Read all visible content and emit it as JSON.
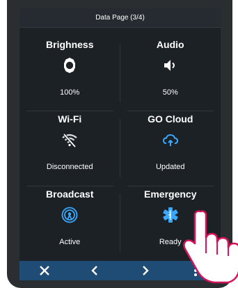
{
  "header": {
    "title": "Data Page (3/4)"
  },
  "tiles": [
    {
      "title": "Brighness",
      "value": "100%",
      "icon": "brightness-icon"
    },
    {
      "title": "Audio",
      "value": "50%",
      "icon": "speaker-icon"
    },
    {
      "title": "Wi-Fi",
      "value": "Disconnected",
      "icon": "wifi-off-icon"
    },
    {
      "title": "GO Cloud",
      "value": "Updated",
      "icon": "cloud-sync-icon"
    },
    {
      "title": "Broadcast",
      "value": "Active",
      "icon": "broadcast-icon"
    },
    {
      "title": "Emergency",
      "value": "Ready",
      "icon": "medical-star-icon"
    }
  ],
  "footer": {
    "buttons": [
      "close-icon",
      "chevron-left-icon",
      "chevron-right-icon",
      "more-vertical-icon"
    ]
  },
  "colors": {
    "background": "#1b2125",
    "accent": "#3aa8ff",
    "footer": "#1e4c75"
  }
}
